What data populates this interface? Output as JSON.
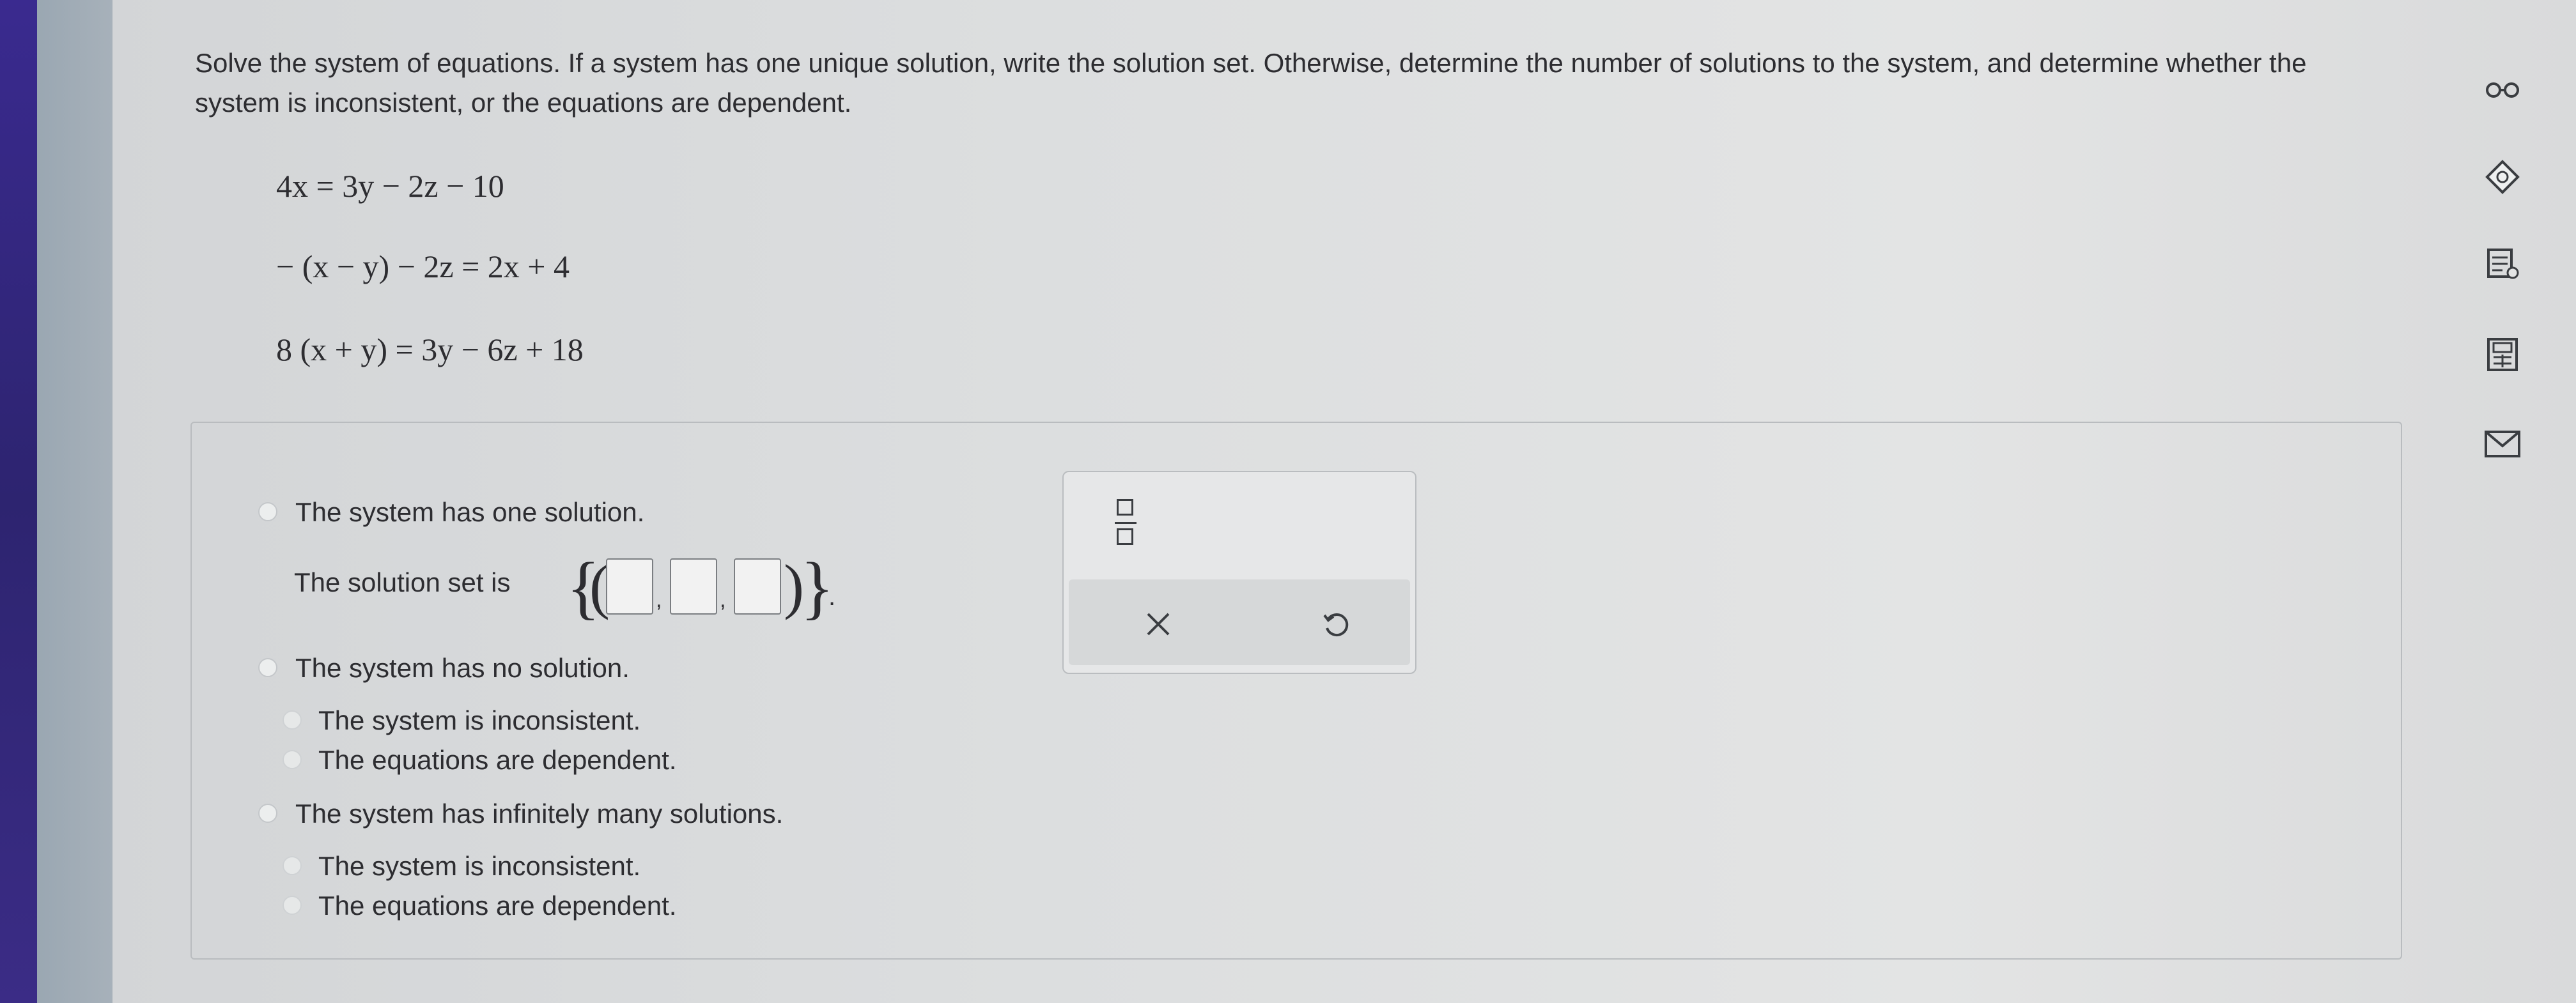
{
  "question": {
    "prompt": "Solve the system of equations. If a system has one unique solution, write the solution set. Otherwise, determine the number of solutions to the system, and determine whether the system is inconsistent, or the equations are dependent.",
    "equations": [
      "4x = 3y − 2z − 10",
      "− (x − y) − 2z = 2x + 4",
      "8 (x + y) = 3y − 6z + 18"
    ]
  },
  "options": {
    "one_solution": "The system has one solution.",
    "solution_set_label": "The solution set is",
    "no_solution": "The system has no solution.",
    "no_solution_sub": [
      "The system is inconsistent.",
      "The equations are dependent."
    ],
    "infinite": "The system has infinitely many solutions.",
    "infinite_sub": [
      "The system is inconsistent.",
      "The equations are dependent."
    ]
  },
  "solution_inputs": {
    "x": "",
    "y": "",
    "z": ""
  },
  "palette": {
    "tools": [
      "fraction-icon",
      "clear-icon",
      "undo-icon"
    ]
  },
  "side_toolbar": {
    "icons": [
      "glasses-icon",
      "hint-icon",
      "textbook-icon",
      "calculator-icon",
      "mail-icon"
    ]
  }
}
